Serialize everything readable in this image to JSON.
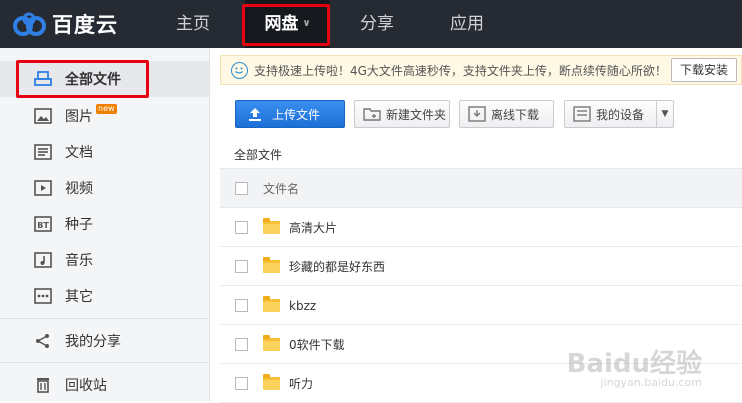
{
  "brand": {
    "name": "百度云"
  },
  "nav": {
    "items": [
      {
        "label": "主页"
      },
      {
        "label": "网盘",
        "active": true
      },
      {
        "label": "分享"
      },
      {
        "label": "应用"
      }
    ]
  },
  "sidebar": {
    "items": [
      {
        "label": "全部文件",
        "icon": "all-files-icon",
        "active": true
      },
      {
        "label": "图片",
        "icon": "image-icon",
        "badge": "new"
      },
      {
        "label": "文档",
        "icon": "document-icon"
      },
      {
        "label": "视频",
        "icon": "video-icon"
      },
      {
        "label": "种子",
        "icon": "bt-icon",
        "icon_text": "BT"
      },
      {
        "label": "音乐",
        "icon": "music-icon"
      },
      {
        "label": "其它",
        "icon": "other-icon"
      },
      {
        "label": "我的分享",
        "icon": "share-icon"
      },
      {
        "label": "回收站",
        "icon": "trash-icon"
      }
    ]
  },
  "notice": {
    "text": "支持极速上传啦！4G大文件高速秒传，支持文件夹上传，断点续传随心所欲！",
    "button": "下载安装"
  },
  "toolbar": {
    "upload": "上传文件",
    "new_folder": "新建文件夹",
    "offline": "离线下载",
    "devices": "我的设备"
  },
  "breadcrumb": "全部文件",
  "table": {
    "header": "文件名",
    "rows": [
      {
        "name": "高清大片"
      },
      {
        "name": "珍藏的都是好东西"
      },
      {
        "name": "kbzz"
      },
      {
        "name": "0软件下载"
      },
      {
        "name": "听力"
      }
    ]
  },
  "watermark": {
    "main": "Baidu经验",
    "sub": "jingyan.baidu.com"
  },
  "colors": {
    "nav_bg": "#262b33",
    "accent": "#1c6fd6",
    "highlight": "#e60012"
  }
}
